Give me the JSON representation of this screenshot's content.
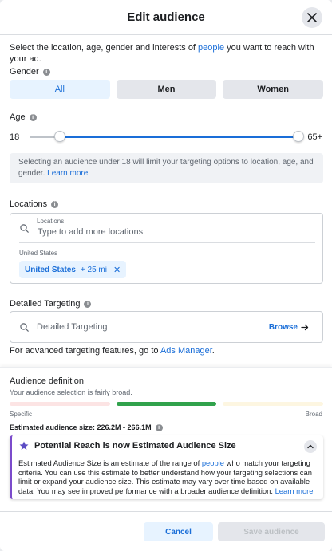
{
  "header": {
    "title": "Edit audience",
    "close_icon": "close-icon"
  },
  "intro": {
    "text_before": "Select the location, age, gender and interests of ",
    "link": "people",
    "text_after": " you want to reach with your ad."
  },
  "gender": {
    "label": "Gender",
    "options": [
      "All",
      "Men",
      "Women"
    ],
    "selected": "All"
  },
  "age": {
    "label": "Age",
    "min": "18",
    "max": "65+",
    "note_text": "Selecting an audience under 18 will limit your targeting options to location, age, and gender. ",
    "note_link": "Learn more"
  },
  "locations": {
    "label": "Locations",
    "input_label": "Locations",
    "placeholder": "Type to add more locations",
    "country": "United States",
    "chip_name": "United States",
    "chip_radius": "+ 25 mi",
    "chip_remove": "✕"
  },
  "detailed_targeting": {
    "label": "Detailed Targeting",
    "placeholder": "Detailed Targeting",
    "browse": "Browse",
    "advanced_text": "For advanced targeting features, go to ",
    "advanced_link": "Ads Manager",
    "advanced_end": "."
  },
  "audience_definition": {
    "title": "Audience definition",
    "subtitle": "Your audience selection is fairly broad.",
    "specific_label": "Specific",
    "broad_label": "Broad",
    "breadth_level": "middle",
    "meter_colors": [
      "#fce4e4",
      "#31a24c",
      "#fdf6e1"
    ],
    "estimated_size": "Estimated audience size: 226.2M - 266.1M"
  },
  "reach_card": {
    "title": "Potential Reach is now Estimated Audience Size",
    "body_before": "Estimated Audience Size is an estimate of the range of ",
    "body_link": "people",
    "body_after": " who match your targeting criteria. You can use this estimate to better understand how your targeting selections can limit or expand your audience size. This estimate may vary over time based on available data. You may see improved performance with a broader audience definition. ",
    "learn_more": "Learn more"
  },
  "footer": {
    "cancel": "Cancel",
    "save": "Save audience"
  },
  "colors": {
    "accent": "#1a6ed8",
    "accent_light": "#e7f3ff",
    "purple": "#7b4bcb"
  }
}
